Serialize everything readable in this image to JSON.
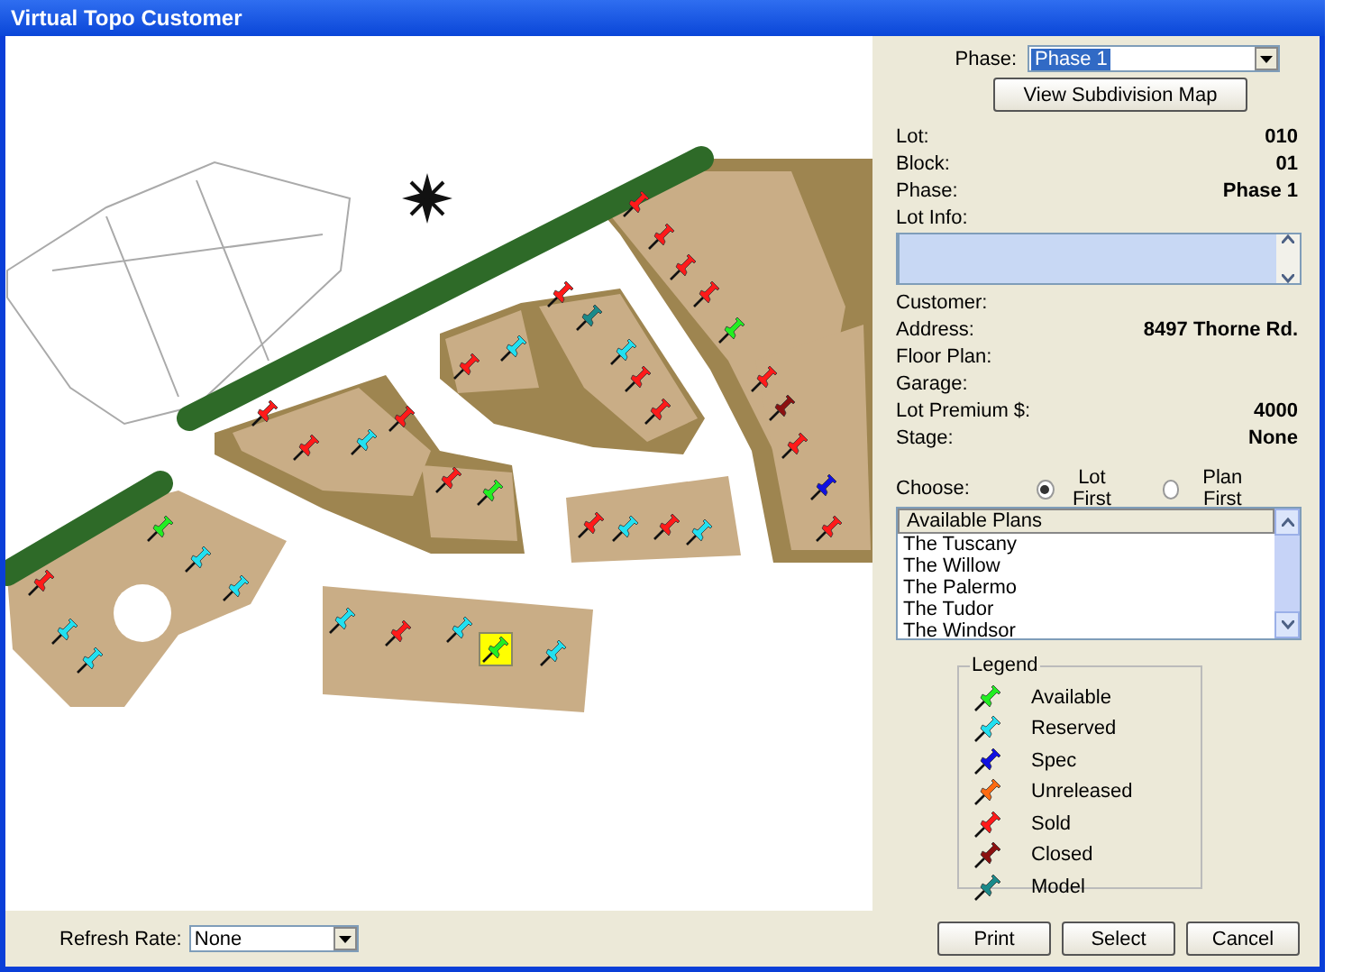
{
  "window": {
    "title": "Virtual Topo Customer"
  },
  "map": {
    "pins": [
      {
        "color": "#ff1a1a",
        "selected": false
      },
      {
        "color": "#ff1a1a",
        "selected": false
      },
      {
        "color": "#ff1a1a",
        "selected": false
      },
      {
        "color": "#ff1a1a",
        "selected": false
      },
      {
        "color": "#22ee22",
        "selected": false
      },
      {
        "color": "#ff1a1a",
        "selected": false
      },
      {
        "color": "#8b1010",
        "selected": false
      },
      {
        "color": "#ff1a1a",
        "selected": false
      },
      {
        "color": "#1010e0",
        "selected": false
      },
      {
        "color": "#ff1a1a",
        "selected": false
      },
      {
        "color": "#ff1a1a",
        "selected": false
      },
      {
        "color": "#1a8a8a",
        "selected": false
      },
      {
        "color": "#22e0f0",
        "selected": false
      },
      {
        "color": "#ff1a1a",
        "selected": false
      },
      {
        "color": "#ff1a1a",
        "selected": false
      },
      {
        "color": "#ff1a1a",
        "selected": false
      },
      {
        "color": "#22e0f0",
        "selected": false
      },
      {
        "color": "#ff1a1a",
        "selected": false
      },
      {
        "color": "#ff1a1a",
        "selected": false
      },
      {
        "color": "#22e0f0",
        "selected": false
      },
      {
        "color": "#ff1a1a",
        "selected": false
      },
      {
        "color": "#ff1a1a",
        "selected": false
      },
      {
        "color": "#22ee22",
        "selected": false
      },
      {
        "color": "#ff1a1a",
        "selected": false
      },
      {
        "color": "#22e0f0",
        "selected": false
      },
      {
        "color": "#ff1a1a",
        "selected": false
      },
      {
        "color": "#22e0f0",
        "selected": false
      },
      {
        "color": "#22ee22",
        "selected": false
      },
      {
        "color": "#22e0f0",
        "selected": false
      },
      {
        "color": "#22e0f0",
        "selected": false
      },
      {
        "color": "#ff1a1a",
        "selected": false
      },
      {
        "color": "#22e0f0",
        "selected": false
      },
      {
        "color": "#22e0f0",
        "selected": false
      },
      {
        "color": "#22e0f0",
        "selected": false
      },
      {
        "color": "#ff1a1a",
        "selected": false
      },
      {
        "color": "#22e0f0",
        "selected": false
      },
      {
        "color": "#22ee22",
        "selected": true
      },
      {
        "color": "#22e0f0",
        "selected": false
      }
    ]
  },
  "panel": {
    "phase": {
      "label": "Phase:",
      "value": "Phase 1"
    },
    "map_button": "View Subdivision Map",
    "fields_top": [
      {
        "label": "Lot:",
        "value": "010"
      },
      {
        "label": "Block:",
        "value": "01"
      },
      {
        "label": "Phase:",
        "value": "Phase 1"
      }
    ],
    "lot_info": {
      "label": "Lot Info:"
    },
    "fields_bottom": [
      {
        "label": "Customer:"
      },
      {
        "label": "Address:",
        "value": "8497 Thorne Rd."
      },
      {
        "label": "Floor Plan:"
      },
      {
        "label": "Garage:"
      },
      {
        "label": "Lot Premium $:",
        "value": "4000"
      },
      {
        "label": "Stage:",
        "value": "None"
      }
    ],
    "choose": {
      "label": "Choose:",
      "options": [
        {
          "label": "Lot First",
          "selected": true
        },
        {
          "label": "Plan First",
          "selected": false
        }
      ]
    },
    "plans": {
      "header": "Available Plans",
      "items": [
        "The Tuscany",
        "The Willow",
        "The Palermo",
        "The Tudor",
        "The Windsor"
      ]
    },
    "legend": {
      "title": "Legend",
      "items": [
        {
          "label": "Available",
          "color": "#22ee22"
        },
        {
          "label": "Reserved",
          "color": "#22e0f0"
        },
        {
          "label": "Spec",
          "color": "#1010e0"
        },
        {
          "label": "Unreleased",
          "color": "#ff6a10"
        },
        {
          "label": "Sold",
          "color": "#ff1a1a"
        },
        {
          "label": "Closed",
          "color": "#8b1010"
        },
        {
          "label": "Model",
          "color": "#1a8a8a"
        }
      ]
    }
  },
  "footer": {
    "refresh": {
      "label": "Refresh Rate:",
      "value": "None"
    },
    "buttons": [
      "Print",
      "Select",
      "Cancel"
    ]
  }
}
